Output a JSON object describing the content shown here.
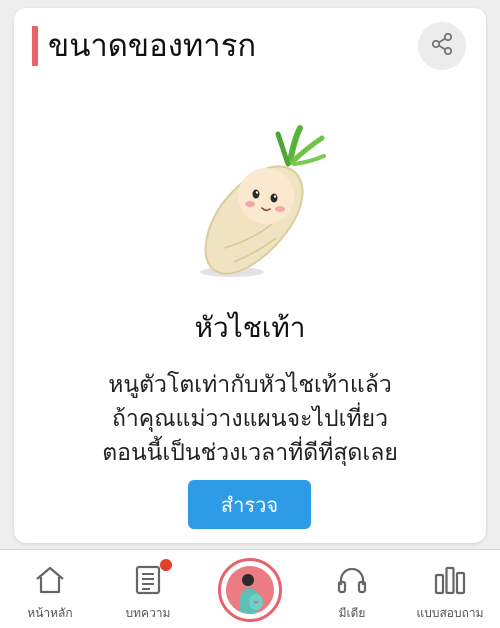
{
  "header": {
    "title": "ขนาดของทารก"
  },
  "size_card": {
    "item_name": "หัวไชเท้า",
    "description_lines": [
      "หนูตัวโตเท่ากับหัวไชเท้าแล้ว",
      "ถ้าคุณแม่วางแผนจะไปเที่ยว",
      "ตอนนี้เป็นช่วงเวลาที่ดีที่สุดเลย"
    ],
    "explore_label": "สำรวจ",
    "button_color": "#2d9be6",
    "accent_color": "#e8626c"
  },
  "bottom_nav": {
    "items": [
      {
        "label": "หน้าหลัก",
        "icon": "home-icon"
      },
      {
        "label": "บทความ",
        "icon": "article-icon",
        "badge": true
      },
      {
        "label": "",
        "icon": "pregnancy-icon"
      },
      {
        "label": "มีเดีย",
        "icon": "headphones-icon"
      },
      {
        "label": "แบบสอบถาม",
        "icon": "bar-chart-icon"
      }
    ]
  }
}
